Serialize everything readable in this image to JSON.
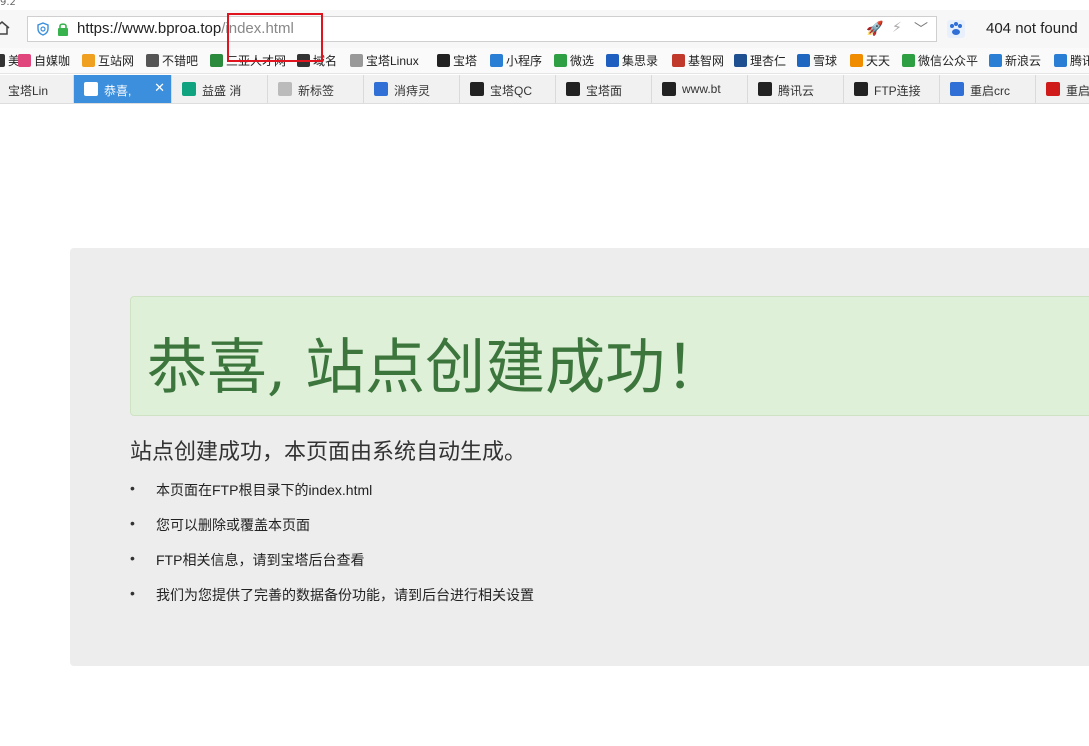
{
  "window": {
    "version_text": "9.2"
  },
  "address_bar": {
    "url_host": "https://www.bproa.top",
    "url_path": "/index.html"
  },
  "search": {
    "text": "404 not found"
  },
  "bookmarks": [
    {
      "label": "美",
      "icon": "cut-icon",
      "color": "#333"
    },
    {
      "label": "自媒咖",
      "icon": "flower-icon",
      "color": "#e0457b"
    },
    {
      "label": "互站网",
      "icon": "site-icon",
      "color": "#f0a020"
    },
    {
      "label": "不错吧",
      "icon": "refresh-icon",
      "color": "#555"
    },
    {
      "label": "三亚人才网",
      "icon": "landscape-icon",
      "color": "#2b8a3e"
    },
    {
      "label": "域名",
      "icon": "domain-icon",
      "color": "#333"
    },
    {
      "label": "宝塔Linux",
      "icon": "page-icon",
      "color": "#999"
    },
    {
      "label": "宝塔",
      "icon": "bt-icon",
      "color": "#222"
    },
    {
      "label": "小程序",
      "icon": "m-icon",
      "color": "#2a7fd4"
    },
    {
      "label": "微选",
      "icon": "select-icon",
      "color": "#2ea043"
    },
    {
      "label": "集思录",
      "icon": "drop-icon",
      "color": "#1f5fbf"
    },
    {
      "label": "基智网",
      "icon": "s-icon",
      "color": "#c0392b"
    },
    {
      "label": "理杏仁",
      "icon": "leaf-icon",
      "color": "#1d4f91"
    },
    {
      "label": "雪球",
      "icon": "snowball-icon",
      "color": "#1f66c1"
    },
    {
      "label": "天天",
      "icon": "rocket-icon",
      "color": "#f08c00"
    },
    {
      "label": "微信公众平",
      "icon": "wechat-icon",
      "color": "#2ea043"
    },
    {
      "label": "新浪云",
      "icon": "cloud-icon",
      "color": "#2a7fd4"
    },
    {
      "label": "腾讯",
      "icon": "cloud-icon",
      "color": "#2a7fd4"
    }
  ],
  "tabs": [
    {
      "label": "宝塔Lin",
      "icon": "none",
      "active": false
    },
    {
      "label": "恭喜,",
      "icon": "page-icon",
      "active": true
    },
    {
      "label": "益盛 消",
      "icon": "medical-icon",
      "active": false
    },
    {
      "label": "新标签",
      "icon": "grid-icon",
      "active": false
    },
    {
      "label": "消痔灵",
      "icon": "paw-icon",
      "active": false
    },
    {
      "label": "宝塔QC",
      "icon": "bt-icon",
      "active": false
    },
    {
      "label": "宝塔面",
      "icon": "bt-icon",
      "active": false
    },
    {
      "label": "www.bt",
      "icon": "bt-icon",
      "active": false
    },
    {
      "label": "腾讯云",
      "icon": "bt-icon",
      "active": false
    },
    {
      "label": "FTP连接",
      "icon": "bt-icon",
      "active": false
    },
    {
      "label": "重启crc",
      "icon": "paw-icon",
      "active": false
    },
    {
      "label": "重启",
      "icon": "c-icon",
      "active": false
    }
  ],
  "page": {
    "title": "恭喜, 站点创建成功！",
    "subtitle": "站点创建成功，本页面由系统自动生成。",
    "items": [
      "本页面在FTP根目录下的index.html",
      "您可以删除或覆盖本页面",
      "FTP相关信息，请到宝塔后台查看",
      "我们为您提供了完善的数据备份功能，请到后台进行相关设置"
    ]
  },
  "colors": {
    "accent_tab": "#3b8fdc",
    "alert_bg": "#dff0d8",
    "alert_text": "#3c763d",
    "highlight_box": "#e0141e"
  }
}
